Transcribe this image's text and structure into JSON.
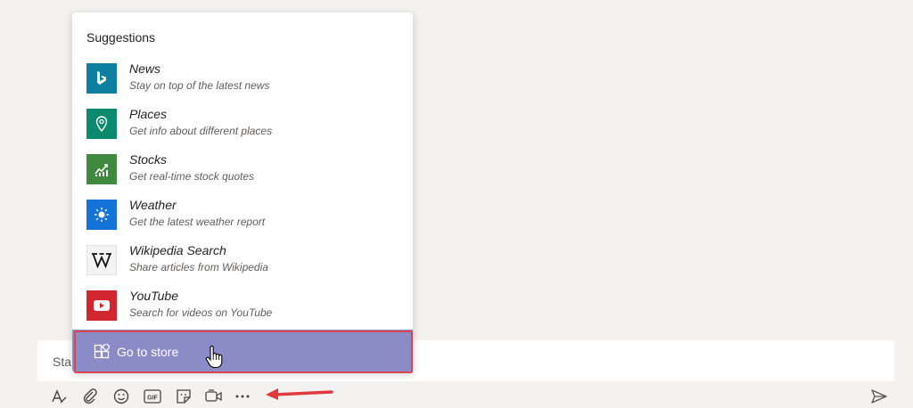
{
  "popup": {
    "title": "Suggestions",
    "items": [
      {
        "name": "News",
        "desc": "Stay on top of the latest news",
        "icon": "bing-icon",
        "color": "#0d7fa0"
      },
      {
        "name": "Places",
        "desc": "Get info about different places",
        "icon": "map-pin-icon",
        "color": "#0b8a6f"
      },
      {
        "name": "Stocks",
        "desc": "Get real-time stock quotes",
        "icon": "stock-chart-icon",
        "color": "#3f8a3f"
      },
      {
        "name": "Weather",
        "desc": "Get the latest weather report",
        "icon": "sun-icon",
        "color": "#1473d6"
      },
      {
        "name": "Wikipedia Search",
        "desc": "Share articles from Wikipedia",
        "icon": "wikipedia-icon",
        "color": "#f3f3f3"
      },
      {
        "name": "YouTube",
        "desc": "Search for videos on YouTube",
        "icon": "youtube-icon",
        "color": "#d0262d"
      }
    ],
    "store_label": "Go to store",
    "store_color": "#8b8cc7",
    "highlight_color": "#d6474f"
  },
  "compose": {
    "placeholder": "Sta"
  },
  "toolbar": {
    "icons": [
      "format-icon",
      "attach-icon",
      "emoji-icon",
      "gif-icon",
      "sticker-icon",
      "meet-now-icon",
      "more-options-icon",
      "send-icon"
    ],
    "gif_label": "GIF",
    "annotation_color": "#e0393e"
  }
}
